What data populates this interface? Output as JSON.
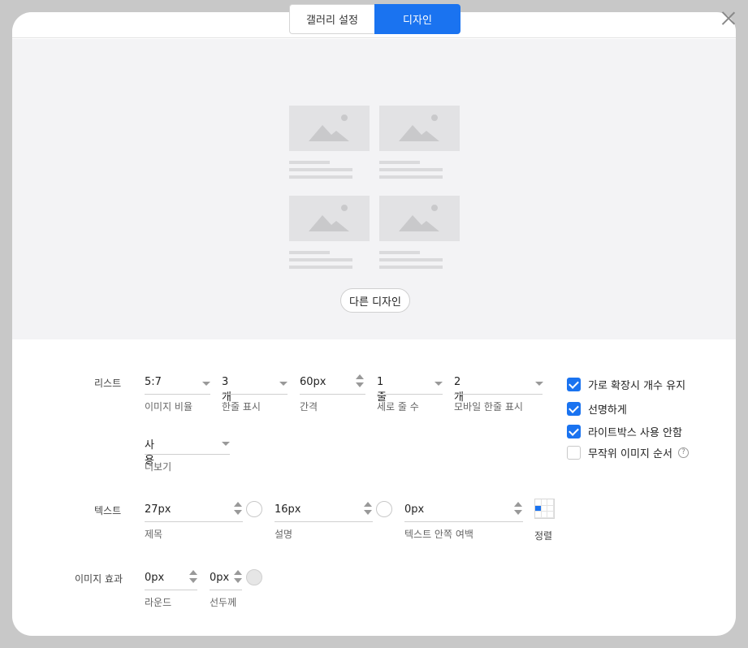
{
  "tabs": [
    {
      "label": "갤러리 설정",
      "active": false
    },
    {
      "label": "디자인",
      "active": true
    }
  ],
  "preview": {
    "other_design_button": "다른 디자인"
  },
  "list_section": {
    "label": "리스트",
    "fields": [
      {
        "value": "5:7",
        "caption": "이미지 비율",
        "control": "dropdown"
      },
      {
        "value": "3개",
        "caption": "한줄 표시",
        "control": "dropdown"
      },
      {
        "value": "60px",
        "caption": "간격",
        "control": "stepper"
      },
      {
        "value": "1줄",
        "caption": "세로 줄 수",
        "control": "dropdown"
      },
      {
        "value": "2개",
        "caption": "모바일 한줄 표시",
        "control": "dropdown"
      },
      {
        "value": "사용",
        "caption": "더보기",
        "control": "dropdown"
      }
    ],
    "checkboxes": [
      {
        "label": "가로 확장시 개수 유지",
        "checked": true
      },
      {
        "label": "선명하게",
        "checked": true
      },
      {
        "label": "라이트박스 사용 안함",
        "checked": true
      },
      {
        "label": "무작위 이미지 순서",
        "checked": false,
        "help_icon": "?"
      }
    ]
  },
  "text_section": {
    "label": "텍스트",
    "fields": [
      {
        "value": "27px",
        "caption": "제목",
        "control": "stepper",
        "color_picker": true
      },
      {
        "value": "16px",
        "caption": "설명",
        "control": "stepper",
        "color_picker": true
      },
      {
        "value": "0px",
        "caption": "텍스트 안쪽 여백",
        "control": "stepper"
      }
    ],
    "align": {
      "caption": "정렬",
      "selected": "middle-left"
    }
  },
  "image_effect_section": {
    "label": "이미지 효과",
    "fields": [
      {
        "value": "0px",
        "caption": "라운드",
        "control": "stepper"
      },
      {
        "value": "0px",
        "caption": "선두께",
        "control": "stepper",
        "color_picker": true
      }
    ]
  },
  "colors": {
    "accent": "#1a73f0",
    "overlay": "#c8c8c8",
    "preview_bg": "#f3f3f5"
  }
}
